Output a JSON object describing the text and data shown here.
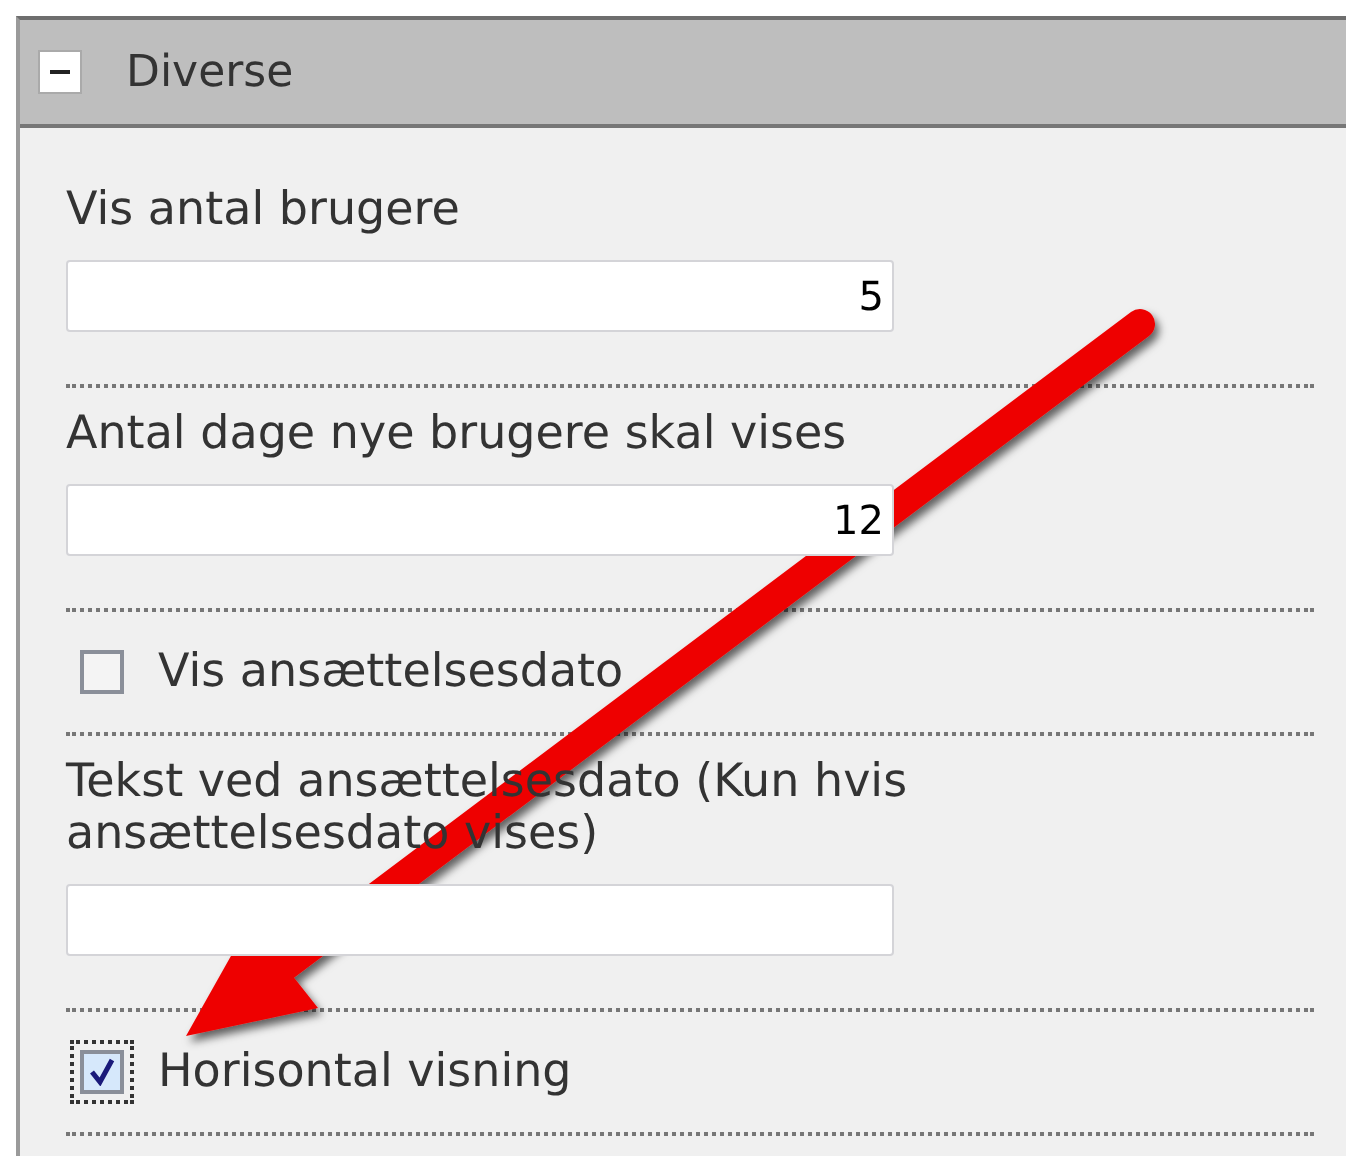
{
  "panel": {
    "title": "Diverse",
    "expanded": true
  },
  "fields": [
    {
      "kind": "number",
      "label": "Vis antal brugere",
      "value": "5"
    },
    {
      "kind": "number",
      "label": "Antal dage nye brugere skal vises",
      "value": "12"
    },
    {
      "kind": "checkbox",
      "label": "Vis ansættelsesdato",
      "checked": false,
      "focused": false
    },
    {
      "kind": "text",
      "label": "Tekst ved ansættelsesdato (Kun hvis ansættelsesdato vises)"
    },
    {
      "kind": "checkbox",
      "label": "Horisontal visning",
      "checked": true,
      "focused": true
    }
  ]
}
